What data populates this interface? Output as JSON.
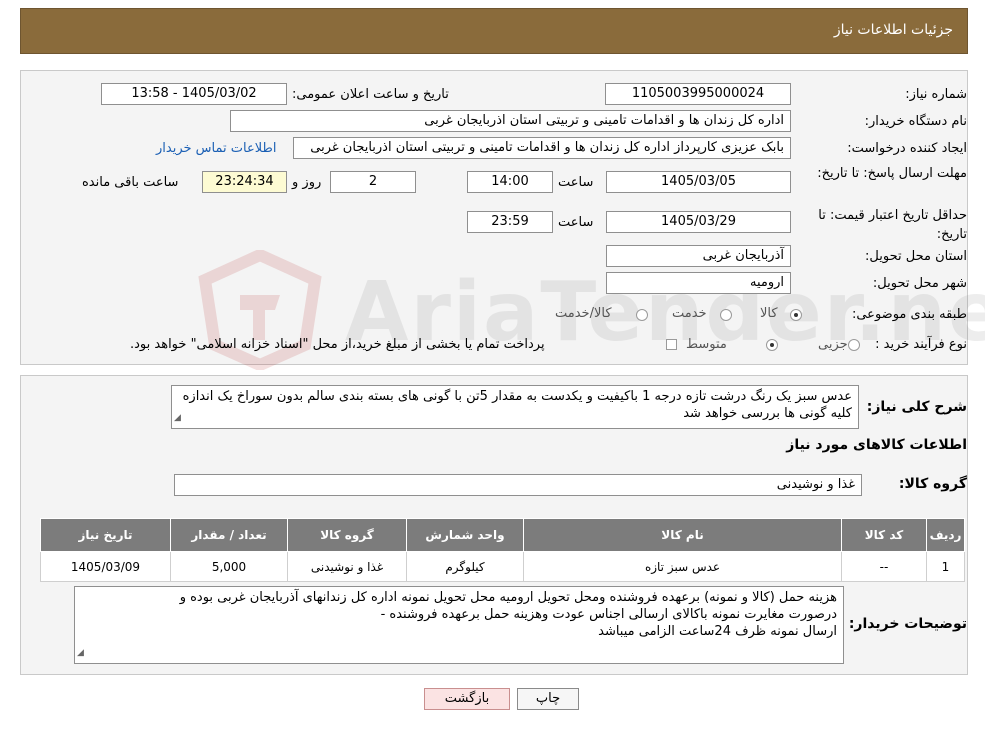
{
  "header": {
    "title": "جزئيات اطلاعات نیاز"
  },
  "form": {
    "need_number_label": "شماره نیاز:",
    "need_number": "1105003995000024",
    "announce_label": "تاریخ و ساعت اعلان عمومی:",
    "announce_value": "1405/03/02 - 13:58",
    "buyer_org_label": "نام دستگاه خريدار:",
    "buyer_org": "اداره کل زندان ها و اقدامات تامینی و تربیتی استان اذربایجان غربی",
    "creator_label": "ایجاد کننده درخواست:",
    "creator": "بابک عزیزی کارپرداز اداره کل زندان ها و اقدامات تامینی و تربیتی استان اذربایجان غربی",
    "contact_link": "اطلاعات تماس خریدار",
    "reply_deadline_label": "مهلت ارسال پاسخ: تا تاریخ:",
    "reply_date": "1405/03/05",
    "time_label": "ساعت",
    "reply_time": "14:00",
    "days_value": "2",
    "days_label": "روز و",
    "remaining_time": "23:24:34",
    "remaining_label": "ساعت باقی مانده",
    "price_validity_label": "حداقل تاریخ اعتبار قیمت: تا تاریخ:",
    "price_date": "1405/03/29",
    "price_time": "23:59",
    "province_label": "استان محل تحویل:",
    "province": "آذربایجان غربی",
    "city_label": "شهر محل تحویل:",
    "city": "ارومیه",
    "category_label": "طبقه بندی موضوعی:",
    "category_options": [
      "کالا",
      "خدمت",
      "کالا/خدمت"
    ],
    "process_label": "نوع فرآیند خرید :",
    "process_options": [
      "جزیی",
      "متوسط"
    ],
    "process_note": "پرداخت تمام یا بخشی از مبلغ خرید،از محل \"اسناد خزانه اسلامی\" خواهد بود."
  },
  "watermark": {
    "text": "AriaTender.neT"
  },
  "summary": {
    "label": "شرح کلی نیاز:",
    "text": "عدس سبز یک رنگ درشت تازه درجه 1 باکیفیت  و یکدست به مقدار 5تن با گونی های بسته بندی سالم بدون سوراخ یک اندازه کلیه گونی ها بررسی خواهد شد",
    "items_title": "اطلاعات کالاهای مورد نیاز",
    "group_label": "گروه کالا:",
    "group_value": "غذا و نوشیدنی"
  },
  "table": {
    "headers": [
      "ردیف",
      "کد کالا",
      "نام کالا",
      "واحد شمارش",
      "گروه کالا",
      "تعداد / مقدار",
      "تاریخ نیاز"
    ],
    "rows": [
      [
        "1",
        "--",
        "عدس سبز تازه",
        "کیلوگرم",
        "غذا و نوشیدنی",
        "5,000",
        "1405/03/09"
      ]
    ]
  },
  "buyer_notes": {
    "label": "توضیحات خریدار:",
    "lines": [
      "هزینه حمل (کالا و نمونه) برعهده فروشنده ومحل تحویل ارومیه  محل تحویل نمونه اداره کل زندانهای آذربایجان غربی بوده و",
      "درصورت مغایرت نمونه باکالای ارسالی اجناس عودت وهزینه حمل برعهده فروشنده -",
      "ارسال نمونه ظرف 24ساعت الزامی میباشد"
    ]
  },
  "buttons": {
    "print": "چاپ",
    "back": "بازگشت"
  }
}
